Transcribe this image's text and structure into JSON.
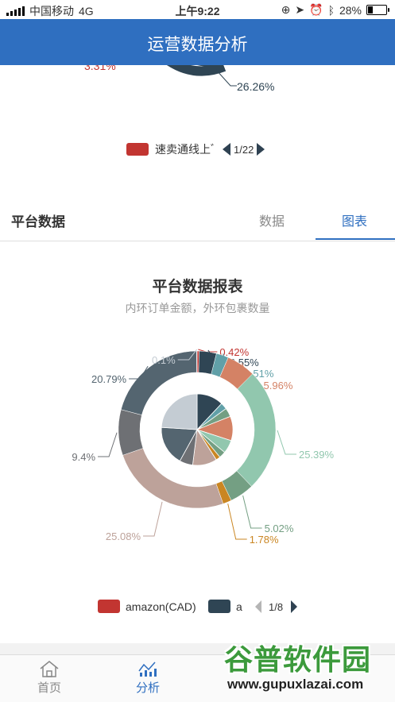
{
  "status_bar": {
    "carrier": "中国移动",
    "network": "4G",
    "time": "上午9:22",
    "battery_percent": "28%",
    "battery_level": 0.28
  },
  "header": {
    "title": "运营数据分析"
  },
  "previous_chart": {
    "partial_label": "3.31%",
    "label": "26.26%",
    "legend_label": "速卖通线上ﾞ",
    "legend_color": "#c23531",
    "pager": "1/22"
  },
  "section": {
    "title": "平台数据",
    "tabs": [
      {
        "label": "数据",
        "active": false
      },
      {
        "label": "图表",
        "active": true
      }
    ]
  },
  "chart_data": {
    "type": "pie",
    "title": "平台数据报表",
    "subtitle": "内环订单金额，外环包裹数量",
    "outer_ring": {
      "slices": [
        {
          "label": "0.42%",
          "value": 0.42,
          "color": "#c23531"
        },
        {
          "label": "3.55%",
          "value": 3.55,
          "color": "#2f4554"
        },
        {
          "label": "2.51%",
          "value": 2.51,
          "color": "#61a0a8"
        },
        {
          "label": "5.96%",
          "value": 5.96,
          "color": "#d48265"
        },
        {
          "label": "25.39%",
          "value": 25.39,
          "color": "#91c7ae"
        },
        {
          "label": "5.02%",
          "value": 5.02,
          "color": "#749f83"
        },
        {
          "label": "1.78%",
          "value": 1.78,
          "color": "#ca8622"
        },
        {
          "label": "25.08%",
          "value": 25.08,
          "color": "#bda29a"
        },
        {
          "label": "9.4%",
          "value": 9.4,
          "color": "#6e7074"
        },
        {
          "label": "20.79%",
          "value": 20.79,
          "color": "#546570"
        },
        {
          "label": "0.1%",
          "value": 0.1,
          "color": "#c4ccd3"
        }
      ]
    },
    "inner_pie": {
      "slices": [
        {
          "value": 12,
          "color": "#2f4554"
        },
        {
          "value": 3,
          "color": "#61a0a8"
        },
        {
          "value": 4,
          "color": "#749f83"
        },
        {
          "value": 11,
          "color": "#d48265"
        },
        {
          "value": 6,
          "color": "#91c7ae"
        },
        {
          "value": 3,
          "color": "#749f83"
        },
        {
          "value": 2,
          "color": "#ca8622"
        },
        {
          "value": 11,
          "color": "#bda29a"
        },
        {
          "value": 6,
          "color": "#6e7074"
        },
        {
          "value": 18,
          "color": "#546570"
        },
        {
          "value": 24,
          "color": "#c4ccd3"
        }
      ]
    },
    "legend": [
      {
        "label": "amazon(CAD)",
        "color": "#c23531"
      },
      {
        "label": "a",
        "color": "#2f4554"
      }
    ],
    "legend_pager": "1/8"
  },
  "tabbar": {
    "items": [
      {
        "label": "首页",
        "active": false
      },
      {
        "label": "分析",
        "active": true
      }
    ]
  },
  "watermark": {
    "text_cn": "谷普软件园",
    "text_url": "www.gupuxlazai.com"
  }
}
